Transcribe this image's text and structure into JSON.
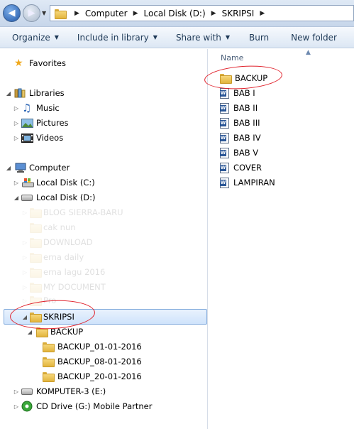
{
  "address_bar": {
    "breadcrumbs": [
      "Computer",
      "Local Disk (D:)",
      "SKRIPSI"
    ],
    "back_icon": "back-arrow-icon",
    "forward_icon": "forward-arrow-icon"
  },
  "toolbar": {
    "organize": "Organize",
    "include_in_library": "Include in library",
    "share_with": "Share with",
    "burn": "Burn",
    "new_folder": "New folder"
  },
  "nav": {
    "favorites": "Favorites",
    "libraries": "Libraries",
    "music": "Music",
    "pictures": "Pictures",
    "videos": "Videos",
    "computer": "Computer",
    "local_disk_c": "Local Disk (C:)",
    "local_disk_d": "Local Disk (D:)",
    "faded_folders": [
      "BLOG SIERRA-BARU",
      "cak nun",
      "DOWNLOAD",
      "erna daily",
      "erna lagu 2016",
      "MY DOCUMENT",
      "Pro"
    ],
    "skripsi": "SKRIPSI",
    "backup": "BACKUP",
    "backup_subfolders": [
      "BACKUP_01-01-2016",
      "BACKUP_08-01-2016",
      "BACKUP_20-01-2016"
    ],
    "komputer3": "KOMPUTER-3 (E:)",
    "cd_drive": "CD Drive (G:) Mobile Partner"
  },
  "content": {
    "column_name": "Name",
    "items": [
      {
        "name": "BACKUP",
        "type": "folder"
      },
      {
        "name": "BAB I",
        "type": "word-doc"
      },
      {
        "name": "BAB II",
        "type": "word-doc"
      },
      {
        "name": "BAB III",
        "type": "word-doc"
      },
      {
        "name": "BAB IV",
        "type": "word-doc"
      },
      {
        "name": "BAB V",
        "type": "word-doc"
      },
      {
        "name": "COVER",
        "type": "word-doc"
      },
      {
        "name": "LAMPIRAN",
        "type": "word-doc"
      }
    ]
  },
  "colors": {
    "annotation_red": "#e0202a",
    "selection_blue": "#cfe3fb"
  }
}
